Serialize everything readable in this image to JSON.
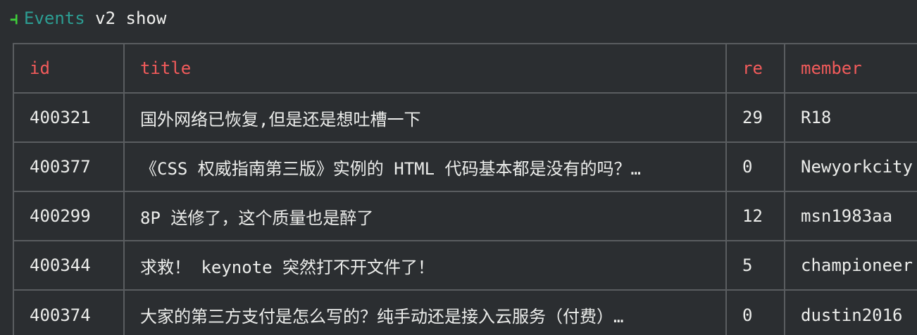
{
  "prompt": {
    "glyph": "⫞",
    "command": "Events",
    "args": " v2 show"
  },
  "colors": {
    "background": "#2b2e31",
    "prompt_glyph": "#3fce3a",
    "command": "#2c9e93",
    "header_text": "#f25b5b",
    "body_text": "#ecedeb",
    "grid_lines": "#5a5d60"
  },
  "table": {
    "columns": [
      "id",
      "title",
      "re",
      "member"
    ],
    "rows": [
      {
        "id": "400321",
        "title": "国外网络已恢复,但是还是想吐槽一下",
        "re": "29",
        "member": "R18"
      },
      {
        "id": "400377",
        "title": "《CSS 权威指南第三版》实例的 HTML 代码基本都是没有的吗？…",
        "re": "0",
        "member": "Newyorkcity"
      },
      {
        "id": "400299",
        "title": "8P 送修了，这个质量也是醉了",
        "re": "12",
        "member": "msn1983aa"
      },
      {
        "id": "400344",
        "title": "求救！ keynote 突然打不开文件了！",
        "re": "5",
        "member": "championeer"
      },
      {
        "id": "400374",
        "title": "大家的第三方支付是怎么写的？纯手动还是接入云服务（付费）…",
        "re": "0",
        "member": "dustin2016"
      }
    ]
  }
}
